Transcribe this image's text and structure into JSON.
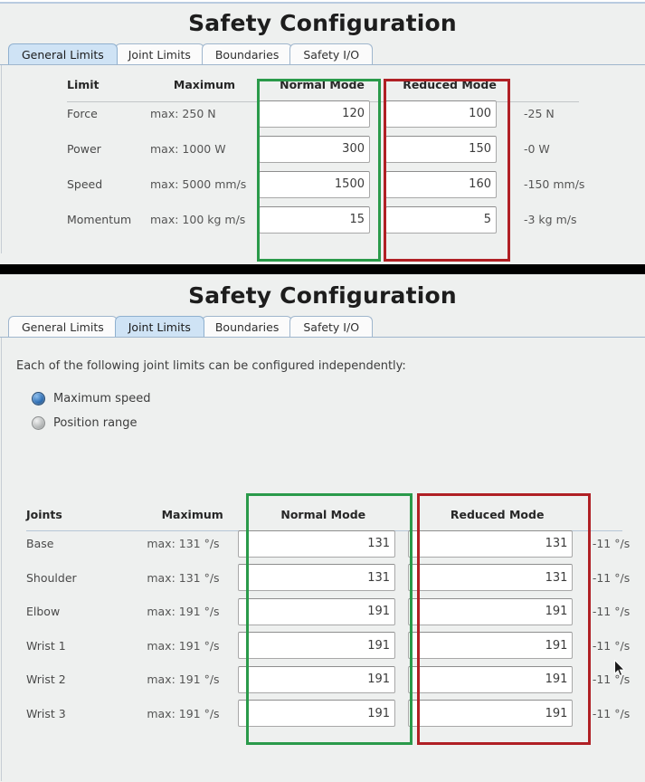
{
  "panels": [
    {
      "title": "Safety Configuration",
      "tabs": [
        {
          "label": "General Limits",
          "active": true
        },
        {
          "label": "Joint Limits",
          "active": false
        },
        {
          "label": "Boundaries",
          "active": false
        },
        {
          "label": "Safety I/O",
          "active": false
        }
      ],
      "table": {
        "headers": {
          "name": "Limit",
          "maximum": "Maximum",
          "normal": "Normal Mode",
          "reduced": "Reduced Mode"
        },
        "rows": [
          {
            "name": "Force",
            "maximum": "max: 250 N",
            "normal": "120",
            "reduced": "100",
            "suffix": "-25 N"
          },
          {
            "name": "Power",
            "maximum": "max: 1000 W",
            "normal": "300",
            "reduced": "150",
            "suffix": "-0 W"
          },
          {
            "name": "Speed",
            "maximum": "max: 5000 mm/s",
            "normal": "1500",
            "reduced": "160",
            "suffix": "-150 mm/s"
          },
          {
            "name": "Momentum",
            "maximum": "max: 100 kg m/s",
            "normal": "15",
            "reduced": "5",
            "suffix": "-3 kg m/s"
          }
        ]
      }
    },
    {
      "title": "Safety Configuration",
      "tabs": [
        {
          "label": "General Limits",
          "active": false
        },
        {
          "label": "Joint Limits",
          "active": true
        },
        {
          "label": "Boundaries",
          "active": false
        },
        {
          "label": "Safety I/O",
          "active": false
        }
      ],
      "description": "Each of the following joint limits can be configured independently:",
      "radios": [
        {
          "label": "Maximum speed",
          "selected": true
        },
        {
          "label": "Position range",
          "selected": false
        }
      ],
      "table": {
        "headers": {
          "name": "Joints",
          "maximum": "Maximum",
          "normal": "Normal Mode",
          "reduced": "Reduced Mode"
        },
        "rows": [
          {
            "name": "Base",
            "maximum": "max: 131 °/s",
            "normal": "131",
            "reduced": "131",
            "suffix": "-11 °/s"
          },
          {
            "name": "Shoulder",
            "maximum": "max: 131 °/s",
            "normal": "131",
            "reduced": "131",
            "suffix": "-11 °/s"
          },
          {
            "name": "Elbow",
            "maximum": "max: 191 °/s",
            "normal": "191",
            "reduced": "191",
            "suffix": "-11 °/s"
          },
          {
            "name": "Wrist 1",
            "maximum": "max: 191 °/s",
            "normal": "191",
            "reduced": "191",
            "suffix": "-11 °/s"
          },
          {
            "name": "Wrist 2",
            "maximum": "max: 191 °/s",
            "normal": "191",
            "reduced": "191",
            "suffix": "-11 °/s"
          },
          {
            "name": "Wrist 3",
            "maximum": "max: 191 °/s",
            "normal": "191",
            "reduced": "191",
            "suffix": "-11 °/s"
          }
        ]
      }
    }
  ],
  "annotations": {
    "green_color": "#2a9a4a",
    "red_color": "#b02025",
    "green_label": "Normal Mode column highlight",
    "red_label": "Reduced Mode column highlight"
  }
}
